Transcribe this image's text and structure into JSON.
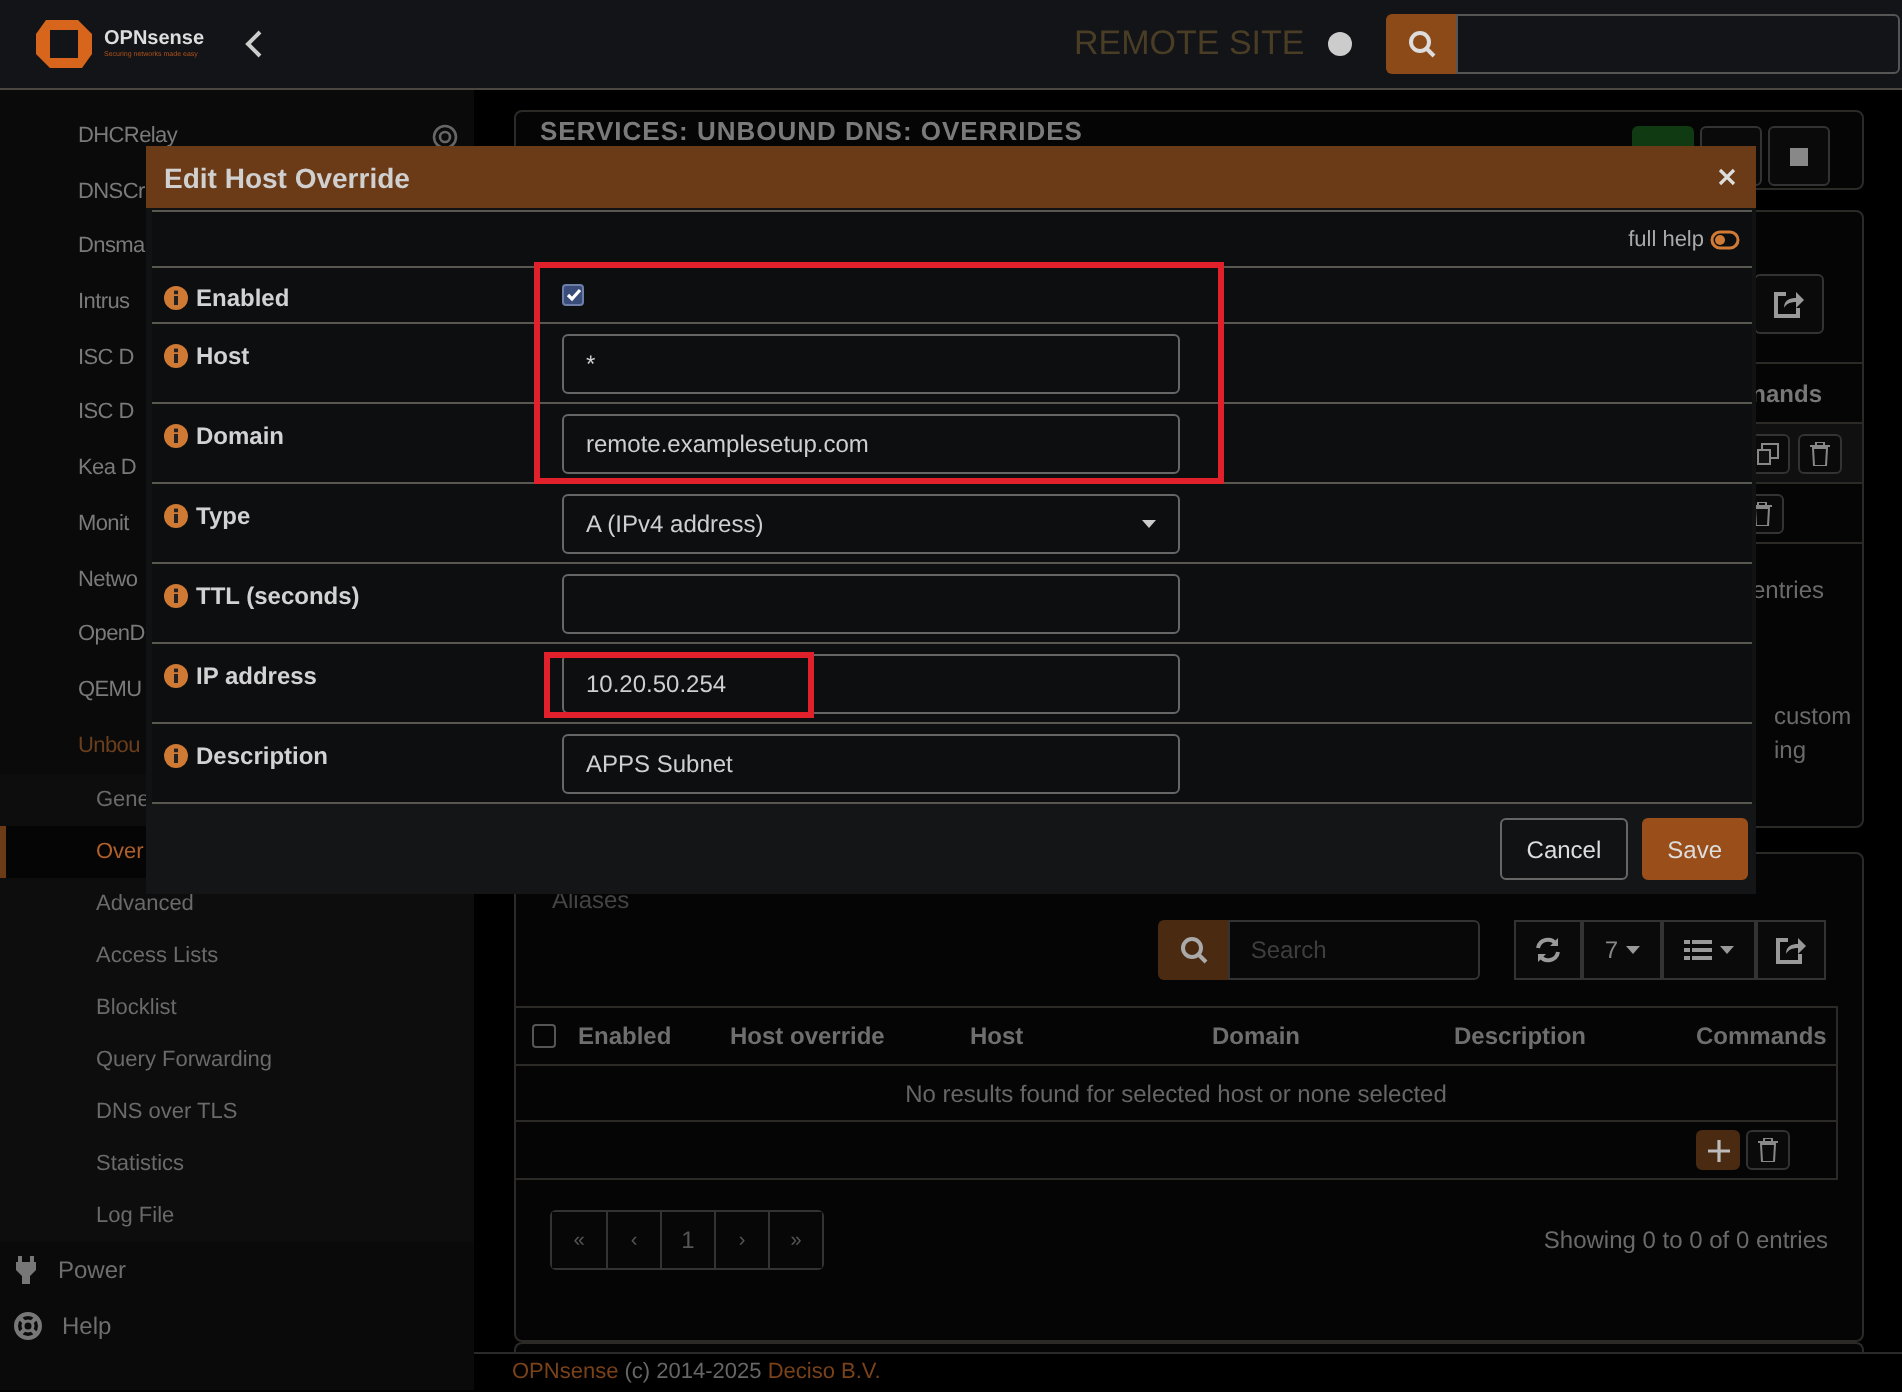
{
  "topbar": {
    "brand": "OPNsense",
    "tagline": "Securing networks made easy",
    "site": "REMOTE SITE"
  },
  "sidebar": {
    "items": [
      {
        "label": "DHCRelay",
        "selected": false
      },
      {
        "label": "DNSCr",
        "selected": false
      },
      {
        "label": "Dnsma",
        "selected": false
      },
      {
        "label": "Intrus",
        "selected": false
      },
      {
        "label": "ISC D",
        "selected": false
      },
      {
        "label": "ISC D",
        "selected": false
      },
      {
        "label": "Kea D",
        "selected": false
      },
      {
        "label": "Monit",
        "selected": false
      },
      {
        "label": "Netwo",
        "selected": false
      },
      {
        "label": "OpenD",
        "selected": false
      },
      {
        "label": "QEMU",
        "selected": false
      },
      {
        "label": "Unbou",
        "selected": true,
        "children": [
          {
            "label": "Gene",
            "selected": false
          },
          {
            "label": "Over",
            "selected": true
          },
          {
            "label": "Advanced",
            "selected": false
          },
          {
            "label": "Access Lists",
            "selected": false
          },
          {
            "label": "Blocklist",
            "selected": false
          },
          {
            "label": "Query Forwarding",
            "selected": false
          },
          {
            "label": "DNS over TLS",
            "selected": false
          },
          {
            "label": "Statistics",
            "selected": false
          },
          {
            "label": "Log File",
            "selected": false
          }
        ]
      }
    ],
    "sections": [
      {
        "label": "Power"
      },
      {
        "label": "Help"
      }
    ]
  },
  "page": {
    "title": "SERVICES: UNBOUND DNS: OVERRIDES"
  },
  "hosts_panel": {
    "commands_header": "nands",
    "info": "entries",
    "note_lines": [
      "custom",
      "ing"
    ]
  },
  "aliases_panel": {
    "title": "Aliases",
    "select_all": false,
    "search": {
      "placeholder": "Search"
    },
    "page_size": "7",
    "columns": [
      "Enabled",
      "Host override",
      "Host",
      "Domain",
      "Description",
      "Commands"
    ],
    "empty_message": "No results found for selected host or none selected",
    "pagination": [
      "«",
      "‹",
      "1",
      "›",
      "»"
    ],
    "info": "Showing 0 to 0 of 0 entries"
  },
  "modal": {
    "title": "Edit Host Override",
    "help_label": "full help",
    "full_help": false,
    "fields": [
      {
        "label": "Enabled",
        "kind": "checkbox",
        "checked": true,
        "highlighted": true
      },
      {
        "label": "Host",
        "kind": "text",
        "value": "*",
        "highlighted": true
      },
      {
        "label": "Domain",
        "kind": "text",
        "value": "remote.examplesetup.com",
        "highlighted": true
      },
      {
        "label": "Type",
        "kind": "select",
        "value": "A (IPv4 address)",
        "highlighted": false
      },
      {
        "label": "TTL (seconds)",
        "kind": "text",
        "highlighted": false
      },
      {
        "label": "IP address",
        "kind": "text",
        "value": "10.20.50.254",
        "highlighted": true
      },
      {
        "label": "Description",
        "kind": "text",
        "value": "APPS Subnet",
        "highlighted": false
      }
    ],
    "buttons": [
      {
        "label": "Cancel",
        "kind": "default"
      },
      {
        "label": "Save",
        "kind": "primary"
      }
    ]
  },
  "footer": {
    "parts": [
      {
        "text": "OPNsense",
        "kind": "link"
      },
      {
        "text": "(c) 2014-2025",
        "kind": "plain"
      },
      {
        "text": "Deciso B.V.",
        "kind": "link"
      }
    ]
  }
}
